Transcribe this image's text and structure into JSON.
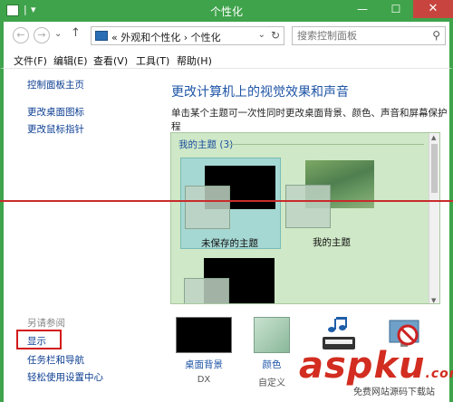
{
  "window": {
    "title": "个性化",
    "close_glyph": "✕",
    "minimize_glyph": "—",
    "maximize_glyph": "☐"
  },
  "address": {
    "crumb_sep": "«",
    "crumb1": "外观和个性化",
    "crumb_arrow": "›",
    "crumb2": "个性化",
    "dropdown": "⌄",
    "refresh": "↻"
  },
  "search": {
    "placeholder": "搜索控制面板",
    "icon": "⚲"
  },
  "nav": {
    "back": "←",
    "forward": "→",
    "recent": "⌄",
    "up": "↑"
  },
  "menu": {
    "file": "文件(F)",
    "edit": "编辑(E)",
    "view": "查看(V)",
    "tools": "工具(T)",
    "help": "帮助(H)"
  },
  "sidebar": {
    "home": "控制面板主页",
    "desktop_icons": "更改桌面图标",
    "mouse_pointers": "更改鼠标指针",
    "see_also": "另请参阅",
    "display": "显示",
    "taskbar": "任务栏和导航",
    "ease": "轻松使用设置中心"
  },
  "main": {
    "heading": "更改计算机上的视觉效果和声音",
    "description": "单击某个主题可一次性同时更改桌面背景、颜色、声音和屏幕保护程"
  },
  "themes": {
    "group": "我的主题",
    "count": "(3)",
    "items": [
      {
        "label": "未保存的主题"
      },
      {
        "label": "我的主题"
      }
    ]
  },
  "bottom": {
    "background": {
      "label": "桌面背景",
      "sub": "DX"
    },
    "color": {
      "label": "颜色",
      "sub": "自定义"
    }
  },
  "watermark": {
    "brand": "asp",
    "brand2": "ku",
    "com": ".com",
    "sub": "免费网站源码下载站"
  }
}
